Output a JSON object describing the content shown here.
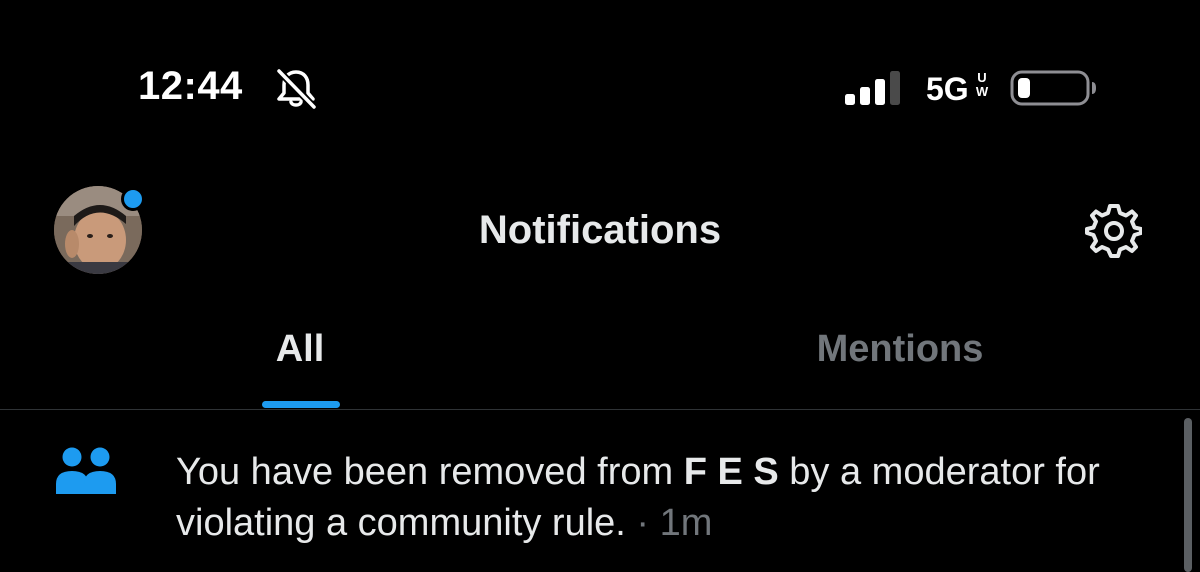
{
  "status_bar": {
    "time": "12:44",
    "network": "5G",
    "network_superscript": "UW",
    "icons": [
      "bell-slash-icon",
      "signal-icon",
      "battery-icon"
    ]
  },
  "header": {
    "title": "Notifications",
    "avatar_badge_color": "#1d9bf0",
    "icons": [
      "avatar",
      "gear-icon"
    ]
  },
  "tabs": [
    {
      "label": "All",
      "active": true
    },
    {
      "label": "Mentions",
      "active": false
    }
  ],
  "colors": {
    "accent": "#1d9bf0",
    "text_primary": "#e7e9ea",
    "text_secondary": "#71767b",
    "background": "#000000"
  },
  "notifications": [
    {
      "icon": "people-icon",
      "text_before": "You have been removed from ",
      "community": "F E S",
      "text_after": " by a moderator for violating a community rule.",
      "separator": " · ",
      "time": "1m"
    }
  ]
}
